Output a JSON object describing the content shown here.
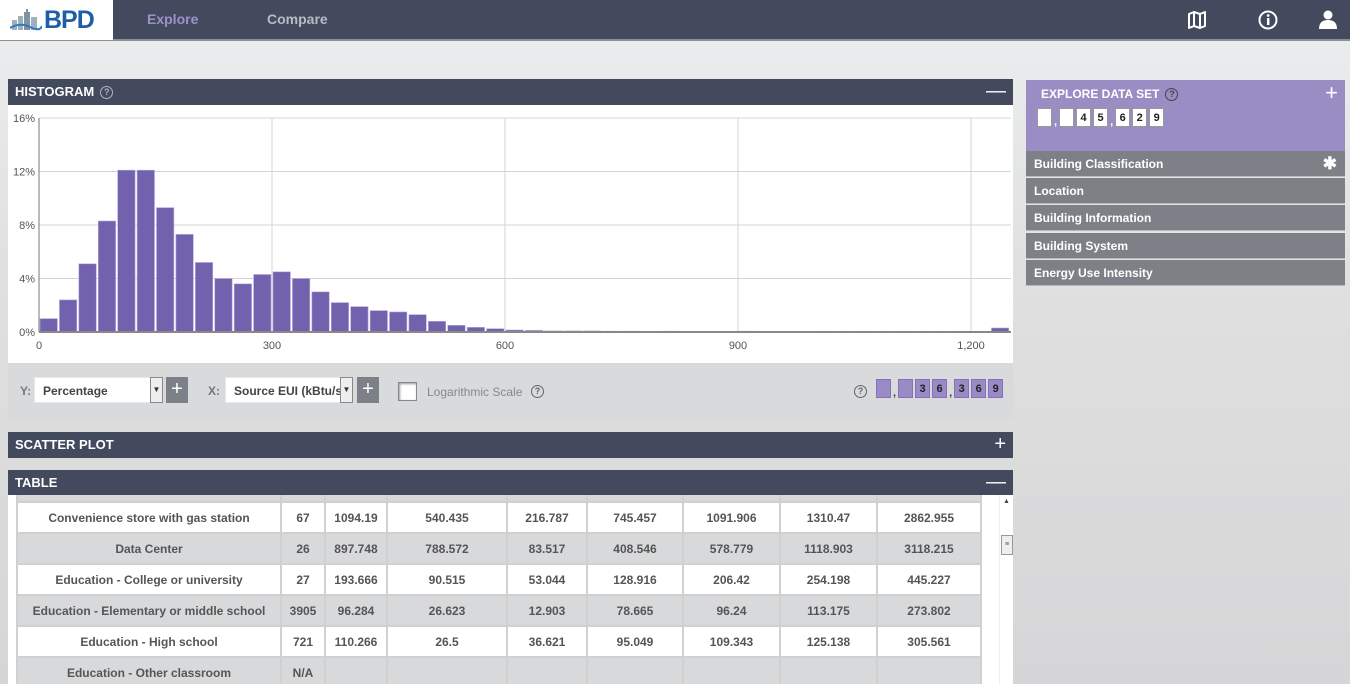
{
  "nav": {
    "logo_text": "BPD",
    "links": [
      {
        "label": "Explore",
        "active": true
      },
      {
        "label": "Compare",
        "active": false
      }
    ],
    "icons": [
      "map-icon",
      "info-icon",
      "user-icon"
    ]
  },
  "histogram": {
    "title": "HISTOGRAM",
    "toggle": "—",
    "controls": {
      "y_label": "Y:",
      "y_value": "Percentage",
      "x_label": "X:",
      "x_value": "Source EUI (kBtu/sf/yr)",
      "log_scale_label": "Logarithmic Scale",
      "log_scale_checked": false,
      "count_digits": [
        " ",
        ",",
        " ",
        "3",
        "6",
        ",",
        "3",
        "6",
        "9"
      ],
      "count_value": "36,369"
    }
  },
  "chart_data": {
    "type": "bar",
    "title": "",
    "xlabel": "Source EUI (kBtu/sf/yr)",
    "ylabel": "Percentage",
    "bin_width": 25,
    "x_ticks": [
      "0",
      "300",
      "600",
      "900",
      "1,200"
    ],
    "x_tick_values": [
      0,
      300,
      600,
      900,
      1200
    ],
    "y_ticks": [
      "0%",
      "4%",
      "8%",
      "12%",
      "16%"
    ],
    "y_tick_values": [
      0,
      4,
      8,
      12,
      16
    ],
    "xlim": [
      0,
      1250
    ],
    "ylim": [
      0,
      16
    ],
    "grid": true,
    "bin_starts": [
      0,
      25,
      50,
      75,
      100,
      125,
      150,
      175,
      200,
      225,
      250,
      275,
      300,
      325,
      350,
      375,
      400,
      425,
      450,
      475,
      500,
      525,
      550,
      575,
      600,
      625,
      650,
      675,
      700,
      725,
      750,
      775,
      800,
      825,
      850,
      875,
      900,
      925,
      950,
      975,
      1000,
      1025,
      1050,
      1075,
      1100,
      1125,
      1150,
      1175,
      1200,
      1225
    ],
    "values": [
      1.0,
      2.4,
      5.1,
      8.3,
      12.1,
      12.1,
      9.3,
      7.3,
      5.2,
      4.0,
      3.6,
      4.3,
      4.5,
      4.0,
      3.0,
      2.2,
      1.9,
      1.6,
      1.5,
      1.3,
      0.8,
      0.5,
      0.35,
      0.25,
      0.15,
      0.12,
      0.08,
      0.08,
      0.08,
      0.06,
      0.06,
      0.05,
      0.06,
      0.05,
      0.05,
      0.04,
      0.06,
      0.04,
      0.05,
      0.03,
      0.02,
      0.02,
      0.02,
      0.02,
      0.02,
      0.02,
      0.02,
      0.02,
      0.02,
      0.3
    ]
  },
  "scatter": {
    "title": "SCATTER PLOT",
    "toggle": "+"
  },
  "table": {
    "title": "TABLE",
    "toggle": "—",
    "rows": [
      [
        "Convenience store with gas station",
        "67",
        "1094.19",
        "540.435",
        "216.787",
        "745.457",
        "1091.906",
        "1310.47",
        "2862.955"
      ],
      [
        "Data Center",
        "26",
        "897.748",
        "788.572",
        "83.517",
        "408.546",
        "578.779",
        "1118.903",
        "3118.215"
      ],
      [
        "Education - College or university",
        "27",
        "193.666",
        "90.515",
        "53.044",
        "128.916",
        "206.42",
        "254.198",
        "445.227"
      ],
      [
        "Education - Elementary or middle school",
        "3905",
        "96.284",
        "26.623",
        "12.903",
        "78.665",
        "96.24",
        "113.175",
        "273.802"
      ],
      [
        "Education - High school",
        "721",
        "110.266",
        "26.5",
        "36.621",
        "95.049",
        "109.343",
        "125.138",
        "305.561"
      ],
      [
        "Education - Other classroom",
        "N/A",
        "",
        "",
        "",
        "",
        "",
        "",
        ""
      ]
    ]
  },
  "explore": {
    "title": "EXPLORE DATA SET",
    "add": "+",
    "count_digits": [
      " ",
      ",",
      " ",
      "4",
      "5",
      ",",
      "6",
      "2",
      "9"
    ],
    "count_value": "45,629",
    "filters": [
      {
        "label": "Building Classification",
        "active": true,
        "marker": "✱"
      },
      {
        "label": "Location"
      },
      {
        "label": "Building Information"
      },
      {
        "label": "Building System"
      },
      {
        "label": "Energy Use Intensity"
      }
    ]
  },
  "colors": {
    "bar": "#7262ad",
    "header": "#434a5e",
    "accent": "#998dc4"
  }
}
